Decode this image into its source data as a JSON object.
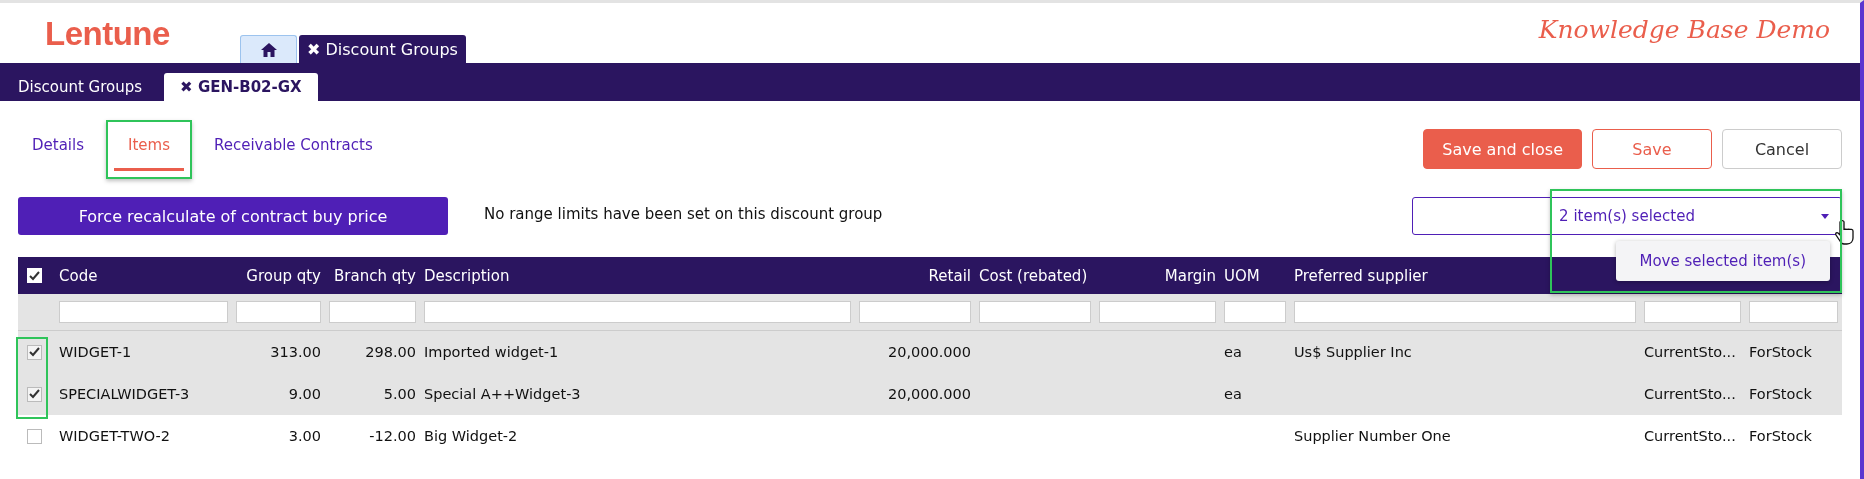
{
  "brand": {
    "logo": "Lentune",
    "tagline": "Knowledge Base Demo"
  },
  "app_tabs": [
    {
      "kind": "home",
      "selected": false
    },
    {
      "kind": "text",
      "label": "✖ Discount Groups",
      "selected": true
    }
  ],
  "sub_tabs": [
    {
      "label": "Discount Groups",
      "selected": false
    },
    {
      "label": "✖ GEN-B02-GX",
      "selected": true
    }
  ],
  "section_tabs": [
    {
      "label": "Details",
      "selected": false,
      "highlighted": false
    },
    {
      "label": "Items",
      "selected": true,
      "highlighted": true
    },
    {
      "label": "Receivable Contracts",
      "selected": false,
      "highlighted": false
    }
  ],
  "actions": [
    {
      "label": "Save and close",
      "kind": "primary"
    },
    {
      "label": "Save",
      "kind": "outline"
    },
    {
      "label": "Cancel",
      "kind": "plain"
    }
  ],
  "recalc_button": "Force recalculate of contract buy price",
  "message": "No range limits have been set on this discount group",
  "selection_dropdown": {
    "value": "2 item(s) selected",
    "highlighted": true,
    "menu": [
      "Move selected item(s)"
    ]
  },
  "table": {
    "all_checked": true,
    "columns": [
      {
        "label": "Code"
      },
      {
        "label": "Group qty"
      },
      {
        "label": "Branch qty"
      },
      {
        "label": "Description"
      },
      {
        "label": "Retail"
      },
      {
        "label": "Cost (rebated)"
      },
      {
        "label": "Margin"
      },
      {
        "label": "UOM"
      },
      {
        "label": "Preferred supplier"
      },
      {},
      {}
    ],
    "rows": [
      {
        "checked": true,
        "cells": [
          "WIDGET-1",
          "313.00",
          "298.00",
          "Imported widget-1",
          "20,000.000",
          "",
          "",
          "ea",
          "Us$ Supplier Inc",
          "CurrentSto...",
          "ForStock"
        ]
      },
      {
        "checked": true,
        "cells": [
          "SPECIALWIDGET-3",
          "9.00",
          "5.00",
          "Special A++Widget-3",
          "20,000.000",
          "",
          "",
          "ea",
          "",
          "CurrentSto...",
          "ForStock"
        ]
      },
      {
        "checked": false,
        "cells": [
          "WIDGET-TWO-2",
          "3.00",
          "-12.00",
          "Big Widget-2",
          "",
          "",
          "",
          "",
          "Supplier Number One",
          "CurrentSto...",
          "ForStock"
        ]
      }
    ],
    "checkbox_highlight": true
  }
}
